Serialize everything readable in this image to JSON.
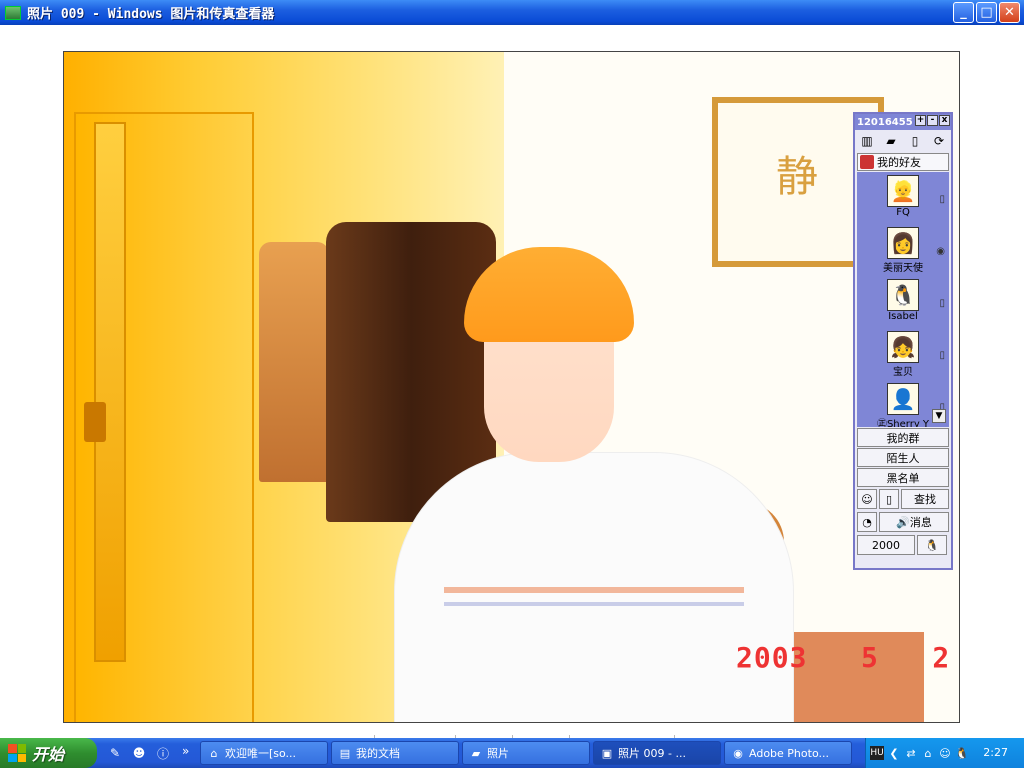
{
  "window": {
    "title": "照片 009 - Windows 图片和传真查看器",
    "minimize": "_",
    "maximize": "□",
    "close": "✕"
  },
  "photo": {
    "date_stamp": "2003   5   2",
    "frame_char": "静"
  },
  "qq": {
    "number": "12016455",
    "title_buttons": [
      "+",
      "-",
      "x"
    ],
    "my_friends": "我的好友",
    "friends": [
      {
        "name": "FQ",
        "face": "👱",
        "status": "▯"
      },
      {
        "name": "美丽天使",
        "face": "👩",
        "status": "◉"
      },
      {
        "name": "Isabel",
        "face": "🐧",
        "status": "▯"
      },
      {
        "name": "宝贝",
        "face": "👧",
        "status": "▯"
      },
      {
        "name": "㊣Sherry Y",
        "face": "👤",
        "status": "▯"
      }
    ],
    "my_group": "我的群",
    "strangers": "陌生人",
    "blacklist": "黑名单",
    "search": "查找",
    "messages": "消息",
    "bottom_label": "2000"
  },
  "toolbar_icons": [
    "prev-icon",
    "next-icon",
    "best-fit-icon",
    "actual-size-icon",
    "slideshow-icon",
    "zoom-in-icon",
    "zoom-out-icon",
    "rotate-cw-icon",
    "rotate-ccw-icon",
    "delete-icon",
    "print-icon",
    "save-icon",
    "edit-icon",
    "help-icon"
  ],
  "taskbar": {
    "start": "开始",
    "chevron": "»",
    "tasks": [
      {
        "label": "欢迎唯一[so...",
        "icon": "⌂"
      },
      {
        "label": "我的文档",
        "icon": "▤"
      },
      {
        "label": "照片",
        "icon": "▰"
      },
      {
        "label": "照片 009 - ...",
        "icon": "▣"
      },
      {
        "label": "Adobe Photo...",
        "icon": "◉"
      }
    ],
    "clock": "2:27",
    "tray_badge": "HU"
  }
}
